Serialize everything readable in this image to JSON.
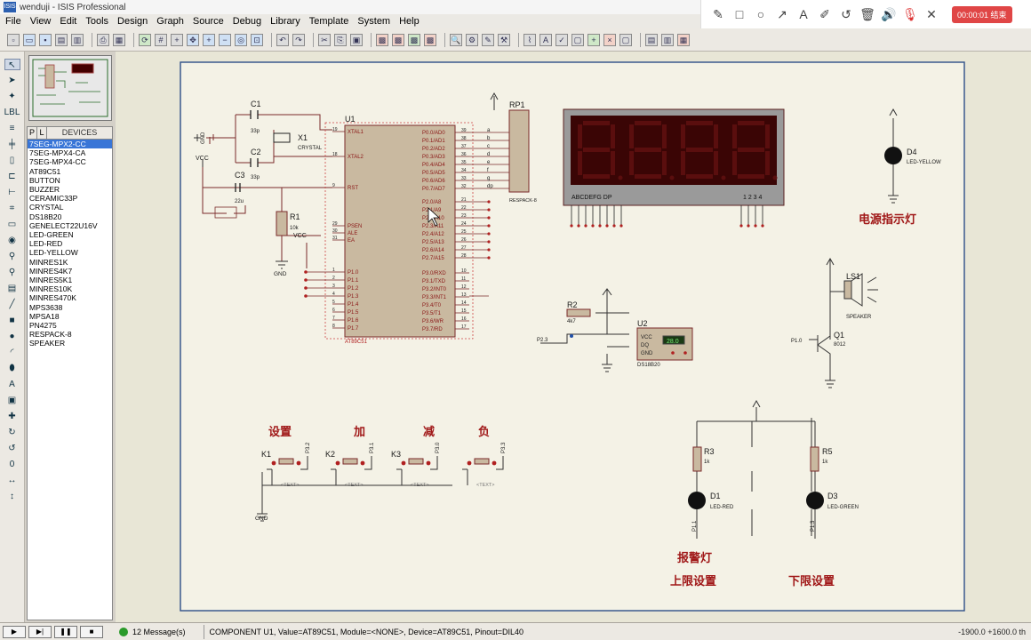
{
  "window": {
    "title": "wenduji - ISIS Professional",
    "app_icon": "ISIS"
  },
  "menu": [
    "File",
    "View",
    "Edit",
    "Tools",
    "Design",
    "Graph",
    "Source",
    "Debug",
    "Library",
    "Template",
    "System",
    "Help"
  ],
  "recorder": {
    "timer": "00:00:01 结束"
  },
  "devices": {
    "tabs": [
      "P",
      "L"
    ],
    "header": "DEVICES",
    "items": [
      "7SEG-MPX2-CC",
      "7SEG-MPX4-CA",
      "7SEG-MPX4-CC",
      "AT89C51",
      "BUTTON",
      "BUZZER",
      "CERAMIC33P",
      "CRYSTAL",
      "DS18B20",
      "GENELECT22U16V",
      "LED-GREEN",
      "LED-RED",
      "LED-YELLOW",
      "MINRES1K",
      "MINRES4K7",
      "MINRES5K1",
      "MINRES10K",
      "MINRES470K",
      "MPS3638",
      "MPSA18",
      "PN4275",
      "RESPACK-8",
      "SPEAKER"
    ],
    "selected": 0
  },
  "schematic": {
    "c1": "C1",
    "c1_val": "33p",
    "c2": "C2",
    "c2_val": "33p",
    "x1": "X1",
    "x1_val": "CRYSTAL",
    "c3": "C3",
    "c3_val": "22u",
    "r1": "R1",
    "r1_val": "10k",
    "gnd": "GND",
    "vcc": "VCC",
    "text": "<TEXT>",
    "u1": "U1",
    "u1_part": "AT89C51",
    "u1_left_pins": [
      "XTAL1",
      "XTAL2",
      "RST",
      "PSEN",
      "ALE",
      "EA",
      "P1.0",
      "P1.1",
      "P1.2",
      "P1.3",
      "P1.4",
      "P1.5",
      "P1.6",
      "P1.7"
    ],
    "u1_left_nums": [
      "19",
      "18",
      "9",
      "29",
      "30",
      "31",
      "1",
      "2",
      "3",
      "4",
      "5",
      "6",
      "7",
      "8"
    ],
    "u1_right_pins": [
      "P0.0/AD0",
      "P0.1/AD1",
      "P0.2/AD2",
      "P0.3/AD3",
      "P0.4/AD4",
      "P0.5/AD5",
      "P0.6/AD6",
      "P0.7/AD7",
      "P2.0/A8",
      "P2.1/A9",
      "P2.2/A10",
      "P2.3/A11",
      "P2.4/A12",
      "P2.5/A13",
      "P2.6/A14",
      "P2.7/A15",
      "P3.0/RXD",
      "P3.1/TXD",
      "P3.2/INT0",
      "P3.3/INT1",
      "P3.4/T0",
      "P3.5/T1",
      "P3.6/WR",
      "P3.7/RD"
    ],
    "u1_right_nums": [
      "39",
      "38",
      "37",
      "36",
      "35",
      "34",
      "33",
      "32",
      "21",
      "22",
      "23",
      "24",
      "25",
      "26",
      "27",
      "28",
      "10",
      "11",
      "12",
      "13",
      "14",
      "15",
      "16",
      "17"
    ],
    "rp1": "RP1",
    "rp1_part": "RESPACK-8",
    "seg_letters": [
      "a",
      "b",
      "c",
      "d",
      "e",
      "f",
      "g",
      "dp"
    ],
    "display_left_label": "ABCDEFG  DP",
    "display_right_label": "1 2 3 4",
    "d4": "D4",
    "d4_part": "LED-YELLOW",
    "power_label": "电源指示灯",
    "r2": "R2",
    "r2_val": "4k7",
    "u2": "U2",
    "u2_part": "DS18B20",
    "u2_reading": "28.0",
    "u2_pins": [
      "VCC",
      "DQ",
      "GND"
    ],
    "p23": "P2.3",
    "ls1": "LS1",
    "ls1_part": "SPEAKER",
    "q1": "Q1",
    "q1_part": "8012",
    "p10": "P1.0",
    "btn_labels": [
      "设置",
      "加",
      "减",
      "负"
    ],
    "keys": [
      "K1",
      "K2",
      "K3"
    ],
    "key_nets": [
      "P3.2",
      "P3.1",
      "P3.0",
      "P3.3"
    ],
    "r3": "R3",
    "r3_val": "1k",
    "r5": "R5",
    "r5_val": "1k",
    "d1": "D1",
    "d1_part": "LED-RED",
    "d3": "D3",
    "d3_part": "LED-GREEN",
    "alarm_label": "报警灯",
    "upper_label": "上限设置",
    "lower_label": "下限设置",
    "p11": "P1.1",
    "p13": "P1.3"
  },
  "status": {
    "messages": "12 Message(s)",
    "text": "COMPONENT U1, Value=AT89C51, Module=<NONE>, Device=AT89C51, Pinout=DIL40",
    "coords": "-1900.0   +1600.0   th"
  }
}
